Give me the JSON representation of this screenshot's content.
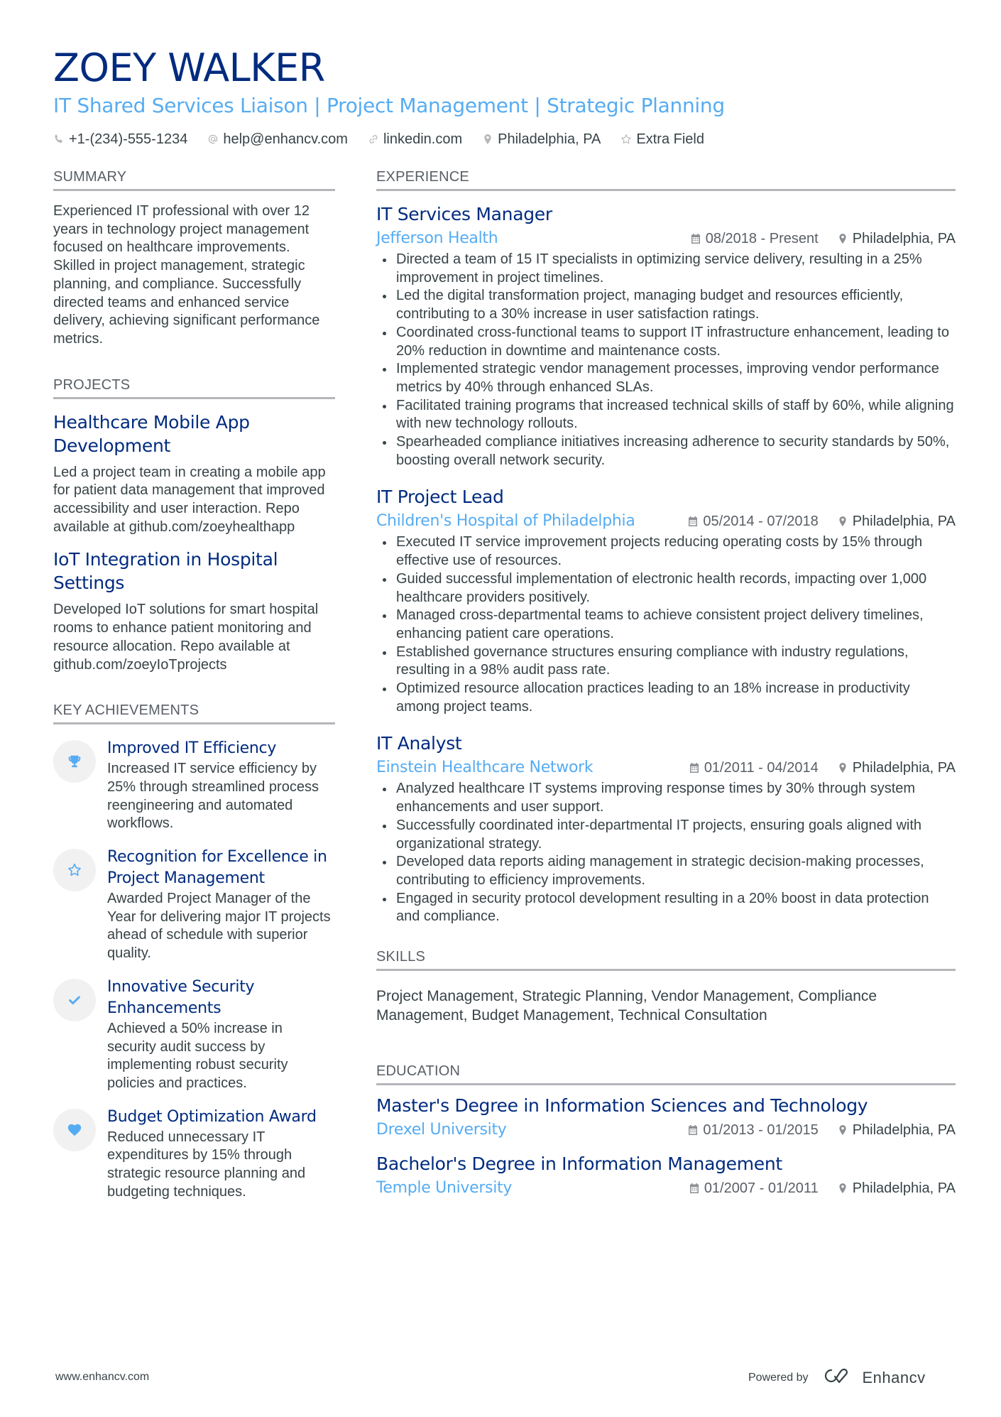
{
  "header": {
    "name": "ZOEY WALKER",
    "headline": "IT Shared Services Liaison | Project Management | Strategic Planning",
    "contacts": [
      {
        "icon": "phone-icon",
        "text": "+1-(234)-555-1234"
      },
      {
        "icon": "at-icon",
        "text": "help@enhancv.com"
      },
      {
        "icon": "link-icon",
        "text": "linkedin.com"
      },
      {
        "icon": "location-icon",
        "text": "Philadelphia, PA"
      },
      {
        "icon": "star-icon",
        "text": "Extra Field"
      }
    ]
  },
  "summary": {
    "title": "SUMMARY",
    "text": "Experienced IT professional with over 12 years in technology project management focused on healthcare improvements. Skilled in project management, strategic planning, and compliance. Successfully directed teams and enhanced service delivery, achieving significant performance metrics."
  },
  "projects": {
    "title": "PROJECTS",
    "items": [
      {
        "title": "Healthcare Mobile App Development",
        "description": "Led a project team in creating a mobile app for patient data management that improved accessibility and user interaction. Repo available at github.com/zoeyhealthapp"
      },
      {
        "title": "IoT Integration in Hospital Settings",
        "description": "Developed IoT solutions for smart hospital rooms to enhance patient monitoring and resource allocation. Repo available at github.com/zoeyIoTprojects"
      }
    ]
  },
  "achievements": {
    "title": "KEY ACHIEVEMENTS",
    "items": [
      {
        "icon": "trophy-icon",
        "title": "Improved IT Efficiency",
        "description": "Increased IT service efficiency by 25% through streamlined process reengineering and automated workflows."
      },
      {
        "icon": "star-icon",
        "title": "Recognition for Excellence in Project Management",
        "description": "Awarded Project Manager of the Year for delivering major IT projects ahead of schedule with superior quality."
      },
      {
        "icon": "check-icon",
        "title": "Innovative Security Enhancements",
        "description": "Achieved a 50% increase in security audit success by implementing robust security policies and practices."
      },
      {
        "icon": "heart-icon",
        "title": "Budget Optimization Award",
        "description": "Reduced unnecessary IT expenditures by 15% through strategic resource planning and budgeting techniques."
      }
    ]
  },
  "experience": {
    "title": "EXPERIENCE",
    "jobs": [
      {
        "title": "IT Services Manager",
        "company": "Jefferson Health",
        "dates": "08/2018 - Present",
        "location": "Philadelphia, PA",
        "bullets": [
          "Directed a team of 15 IT specialists in optimizing service delivery, resulting in a 25% improvement in project timelines.",
          "Led the digital transformation project, managing budget and resources efficiently, contributing to a 30% increase in user satisfaction ratings.",
          "Coordinated cross-functional teams to support IT infrastructure enhancement, leading to 20% reduction in downtime and maintenance costs.",
          "Implemented strategic vendor management processes, improving vendor performance metrics by 40% through enhanced SLAs.",
          "Facilitated training programs that increased technical skills of staff by 60%, while aligning with new technology rollouts.",
          "Spearheaded compliance initiatives increasing adherence to security standards by 50%, boosting overall network security."
        ]
      },
      {
        "title": "IT Project Lead",
        "company": "Children's Hospital of Philadelphia",
        "dates": "05/2014 - 07/2018",
        "location": "Philadelphia, PA",
        "bullets": [
          "Executed IT service improvement projects reducing operating costs by 15% through effective use of resources.",
          "Guided successful implementation of electronic health records, impacting over 1,000 healthcare providers positively.",
          "Managed cross-departmental teams to achieve consistent project delivery timelines, enhancing patient care operations.",
          "Established governance structures ensuring compliance with industry regulations, resulting in a 98% audit pass rate.",
          "Optimized resource allocation practices leading to an 18% increase in productivity among project teams."
        ]
      },
      {
        "title": "IT Analyst",
        "company": "Einstein Healthcare Network",
        "dates": "01/2011 - 04/2014",
        "location": "Philadelphia, PA",
        "bullets": [
          "Analyzed healthcare IT systems improving response times by 30% through system enhancements and user support.",
          "Successfully coordinated inter-departmental IT projects, ensuring goals aligned with organizational strategy.",
          "Developed data reports aiding management in strategic decision-making processes, contributing to efficiency improvements.",
          "Engaged in security protocol development resulting in a 20% boost in data protection and compliance."
        ]
      }
    ]
  },
  "skills": {
    "title": "SKILLS",
    "text": "Project Management, Strategic Planning, Vendor Management, Compliance Management, Budget Management, Technical Consultation"
  },
  "education": {
    "title": "EDUCATION",
    "items": [
      {
        "degree": "Master's Degree in Information Sciences and Technology",
        "school": "Drexel University",
        "dates": "01/2013 - 01/2015",
        "location": "Philadelphia, PA"
      },
      {
        "degree": "Bachelor's Degree in Information Management",
        "school": "Temple University",
        "dates": "01/2007 - 01/2011",
        "location": "Philadelphia, PA"
      }
    ]
  },
  "footer": {
    "website": "www.enhancv.com",
    "powered_by": "Powered by",
    "brand": "Enhancv"
  },
  "colors": {
    "name": "#002b7f",
    "accent": "#56acf2",
    "text": "#384347",
    "rule": "#b4b6b9"
  }
}
